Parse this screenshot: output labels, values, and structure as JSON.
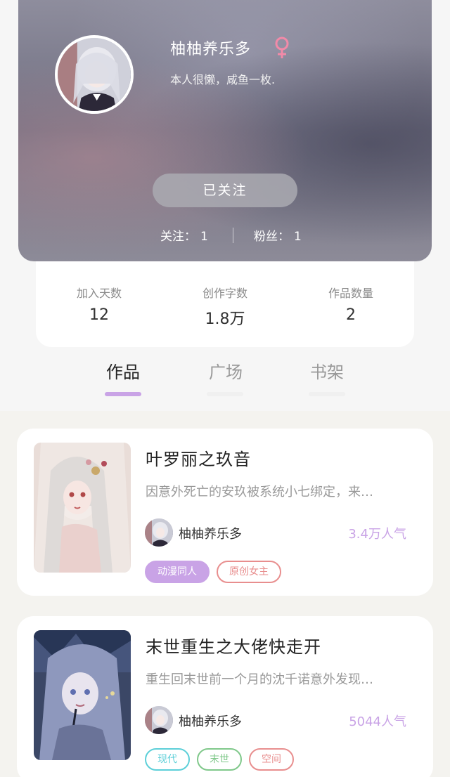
{
  "profile": {
    "name": "柚柚养乐多",
    "gender_icon": "female-icon",
    "bio": "本人很懒，咸鱼一枚.",
    "follow_button": "已关注",
    "following_label": "关注：",
    "following_count": "1",
    "fans_label": "粉丝：",
    "fans_count": "1"
  },
  "stats": [
    {
      "label": "加入天数",
      "value": "12"
    },
    {
      "label": "创作字数",
      "value": "1.8万"
    },
    {
      "label": "作品数量",
      "value": "2"
    }
  ],
  "tabs": [
    {
      "label": "作品",
      "active": true
    },
    {
      "label": "广场",
      "active": false
    },
    {
      "label": "书架",
      "active": false
    }
  ],
  "colors": {
    "accent_purple": "#c9a3e6",
    "tab_underline": "#c9a3e6",
    "tag_cyan": "#5ccfd8",
    "tag_green": "#7fc88a",
    "tag_red": "#e88e8e"
  },
  "works": [
    {
      "title": "叶罗丽之玖音",
      "description": "因意外死亡的安玖被系统小七绑定，来…",
      "author": "柚柚养乐多",
      "popularity": "3.4万人气",
      "tags": [
        {
          "label": "动漫同人",
          "style": "filled-purple"
        },
        {
          "label": "原创女主",
          "style": "outline-red"
        }
      ]
    },
    {
      "title": "末世重生之大佬快走开",
      "description": "重生回末世前一个月的沈千诺意外发现…",
      "author": "柚柚养乐多",
      "popularity": "5044人气",
      "tags": [
        {
          "label": "现代",
          "style": "outline-cyan"
        },
        {
          "label": "末世",
          "style": "outline-green"
        },
        {
          "label": "空间",
          "style": "outline-red"
        }
      ]
    }
  ]
}
